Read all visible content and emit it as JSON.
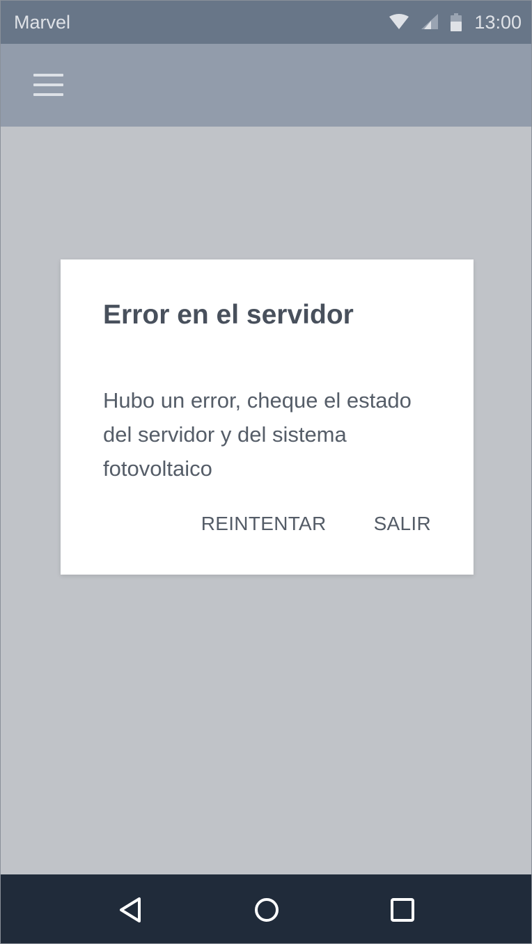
{
  "status_bar": {
    "carrier": "Marvel",
    "time": "13:00",
    "icons": [
      "wifi-icon",
      "signal-icon",
      "battery-icon"
    ]
  },
  "app_bar": {
    "menu_icon": "hamburger-menu-icon"
  },
  "dialog": {
    "title": "Error en el servidor",
    "message": "Hubo un error, cheque el estado del servidor y del sistema fotovoltaico",
    "actions": {
      "retry_label": "REINTENTAR",
      "exit_label": "SALIR"
    }
  },
  "nav_bar": {
    "icons": [
      "back-icon",
      "home-icon",
      "recents-icon"
    ]
  },
  "colors": {
    "status_bar": "#687688",
    "app_bar": "#929cab",
    "scrim": "#c0c3c8",
    "dialog": "#ffffff",
    "nav_bar": "#202b3a"
  }
}
